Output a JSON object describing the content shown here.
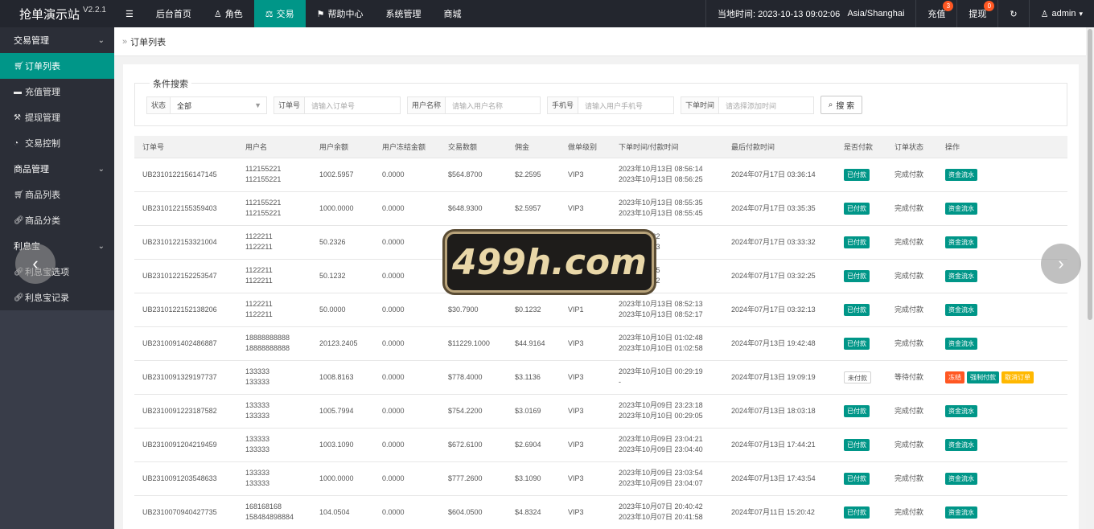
{
  "app": {
    "brand": "抢单演示站",
    "version": "V2.2.1"
  },
  "topnav": {
    "menu_icon": "menu-icon",
    "items": [
      {
        "label": "后台首页",
        "icon": ""
      },
      {
        "label": "角色",
        "icon": "user-icon"
      },
      {
        "label": "交易",
        "icon": "scale-icon",
        "active": true
      },
      {
        "label": "帮助中心",
        "icon": "flag-icon"
      },
      {
        "label": "系统管理",
        "icon": ""
      },
      {
        "label": "商城",
        "icon": ""
      }
    ],
    "time_label": "当地时间: 2023-10-13 09:02:06",
    "timezone": "Asia/Shanghai",
    "recharge": {
      "label": "充值",
      "count": "3"
    },
    "withdraw": {
      "label": "提现",
      "count": "0"
    },
    "user": "admin"
  },
  "sidebar": {
    "groups": [
      {
        "label": "交易管理",
        "items": [
          {
            "label": "订单列表",
            "icon": "cart-icon",
            "active": true
          },
          {
            "label": "充值管理",
            "icon": "monitor-icon"
          },
          {
            "label": "提现管理",
            "icon": "hammer-icon"
          },
          {
            "label": "交易控制",
            "icon": "dashboard-icon"
          }
        ]
      },
      {
        "label": "商品管理",
        "items": [
          {
            "label": "商品列表",
            "icon": "cart-icon"
          },
          {
            "label": "商品分类",
            "icon": "link-icon"
          }
        ]
      },
      {
        "label": "利息宝",
        "items": [
          {
            "label": "利息宝选项",
            "icon": "link-icon"
          },
          {
            "label": "利息宝记录",
            "icon": "link-icon"
          }
        ]
      }
    ]
  },
  "breadcrumb": "订单列表",
  "search": {
    "legend": "条件搜索",
    "status_label": "状态",
    "status_value": "全部",
    "order_label": "订单号",
    "order_placeholder": "请输入订单号",
    "username_label": "用户名称",
    "username_placeholder": "请输入用户名称",
    "phone_label": "手机号",
    "phone_placeholder": "请输入用户手机号",
    "time_label": "下单时间",
    "time_placeholder": "请选择添加时间",
    "button": "搜 索"
  },
  "table": {
    "headers": [
      "订单号",
      "用户名",
      "用户余额",
      "用户冻结金额",
      "交易数额",
      "佣金",
      "做单级别",
      "下单时间/付款时间",
      "最后付款时间",
      "是否付款",
      "订单状态",
      "操作"
    ],
    "rows": [
      {
        "order": "UB2310122156147145",
        "user1": "112155221",
        "user2": "112155221",
        "balance": "1002.5957",
        "frozen": "0.0000",
        "amount": "$564.8700",
        "commission": "$2.2595",
        "level": "VIP3",
        "t1": "2023年10月13日 08:56:14",
        "t2": "2023年10月13日 08:56:25",
        "last": "2024年07月17日 03:36:14",
        "paid": "已付款",
        "status": "完成付款",
        "actions": [
          "资金流水"
        ]
      },
      {
        "order": "UB2310122155359403",
        "user1": "112155221",
        "user2": "112155221",
        "balance": "1000.0000",
        "frozen": "0.0000",
        "amount": "$648.9300",
        "commission": "$2.5957",
        "level": "VIP3",
        "t1": "2023年10月13日 08:55:35",
        "t2": "2023年10月13日 08:55:45",
        "last": "2024年07月17日 03:35:35",
        "paid": "已付款",
        "status": "完成付款",
        "actions": [
          "资金流水"
        ]
      },
      {
        "order": "UB2310122153321004",
        "user1": "1122211",
        "user2": "1122211",
        "balance": "50.2326",
        "frozen": "0.0000",
        "amount": "",
        "commission": "",
        "level": "",
        "t1": "3日 08:53:32",
        "t2": "3日 08:53:43",
        "last": "2024年07月17日 03:33:32",
        "paid": "已付款",
        "status": "完成付款",
        "actions": [
          "资金流水"
        ]
      },
      {
        "order": "UB2310122152253547",
        "user1": "1122211",
        "user2": "1122211",
        "balance": "50.1232",
        "frozen": "0.0000",
        "amount": "",
        "commission": "",
        "level": "",
        "t1": "3日 08:52:25",
        "t2": "3日 08:52:52",
        "last": "2024年07月17日 03:32:25",
        "paid": "已付款",
        "status": "完成付款",
        "actions": [
          "资金流水"
        ]
      },
      {
        "order": "UB2310122152138206",
        "user1": "1122211",
        "user2": "1122211",
        "balance": "50.0000",
        "frozen": "0.0000",
        "amount": "$30.7900",
        "commission": "$0.1232",
        "level": "VIP1",
        "t1": "2023年10月13日 08:52:13",
        "t2": "2023年10月13日 08:52:17",
        "last": "2024年07月17日 03:32:13",
        "paid": "已付款",
        "status": "完成付款",
        "actions": [
          "资金流水"
        ]
      },
      {
        "order": "UB2310091402486887",
        "user1": "18888888888",
        "user2": "18888888888",
        "balance": "20123.2405",
        "frozen": "0.0000",
        "amount": "$11229.1000",
        "commission": "$44.9164",
        "level": "VIP3",
        "t1": "2023年10月10日 01:02:48",
        "t2": "2023年10月10日 01:02:58",
        "last": "2024年07月13日 19:42:48",
        "paid": "已付款",
        "status": "完成付款",
        "actions": [
          "资金流水"
        ]
      },
      {
        "order": "UB2310091329197737",
        "user1": "133333",
        "user2": "133333",
        "balance": "1008.8163",
        "frozen": "0.0000",
        "amount": "$778.4000",
        "commission": "$3.1136",
        "level": "VIP3",
        "t1": "2023年10月10日 00:29:19",
        "t2": "-",
        "last": "2024年07月13日 19:09:19",
        "paid": "未付款",
        "status": "等待付款",
        "actions": [
          "冻结",
          "强制付款",
          "取消订单"
        ]
      },
      {
        "order": "UB2310091223187582",
        "user1": "133333",
        "user2": "133333",
        "balance": "1005.7994",
        "frozen": "0.0000",
        "amount": "$754.2200",
        "commission": "$3.0169",
        "level": "VIP3",
        "t1": "2023年10月09日 23:23:18",
        "t2": "2023年10月10日 00:29:05",
        "last": "2024年07月13日 18:03:18",
        "paid": "已付款",
        "status": "完成付款",
        "actions": [
          "资金流水"
        ]
      },
      {
        "order": "UB2310091204219459",
        "user1": "133333",
        "user2": "133333",
        "balance": "1003.1090",
        "frozen": "0.0000",
        "amount": "$672.6100",
        "commission": "$2.6904",
        "level": "VIP3",
        "t1": "2023年10月09日 23:04:21",
        "t2": "2023年10月09日 23:04:40",
        "last": "2024年07月13日 17:44:21",
        "paid": "已付款",
        "status": "完成付款",
        "actions": [
          "资金流水"
        ]
      },
      {
        "order": "UB2310091203548633",
        "user1": "133333",
        "user2": "133333",
        "balance": "1000.0000",
        "frozen": "0.0000",
        "amount": "$777.2600",
        "commission": "$3.1090",
        "level": "VIP3",
        "t1": "2023年10月09日 23:03:54",
        "t2": "2023年10月09日 23:04:07",
        "last": "2024年07月13日 17:43:54",
        "paid": "已付款",
        "status": "完成付款",
        "actions": [
          "资金流水"
        ]
      },
      {
        "order": "UB2310070940427735",
        "user1": "168168168",
        "user2": "158484898884",
        "balance": "104.0504",
        "frozen": "0.0000",
        "amount": "$604.0500",
        "commission": "$4.8324",
        "level": "VIP3",
        "t1": "2023年10月07日 20:40:42",
        "t2": "2023年10月07日 20:41:58",
        "last": "2024年07月11日 15:20:42",
        "paid": "已付款",
        "status": "完成付款",
        "actions": [
          "资金流水"
        ]
      }
    ]
  },
  "overlay": {
    "logo_text": "499h.com",
    "prev_icon": "chevron-left-icon",
    "next_icon": "chevron-right-icon"
  },
  "colors": {
    "accent": "#009688",
    "dark": "#23262e",
    "sidebar": "#393d49",
    "danger": "#ff5722",
    "warn": "#ffb800"
  }
}
